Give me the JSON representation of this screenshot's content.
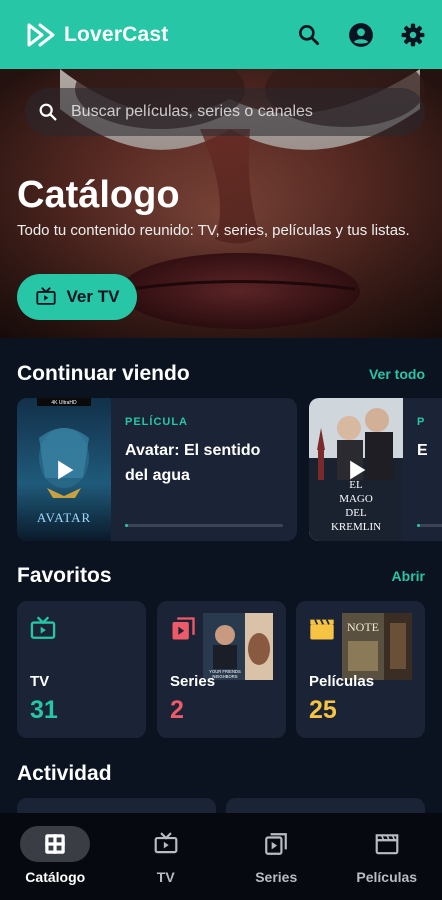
{
  "app": {
    "name": "LoverCast"
  },
  "header": {
    "icons": [
      "search-icon",
      "account-icon",
      "gear-icon"
    ]
  },
  "hero": {
    "search_placeholder": "Buscar películas, series o canales",
    "title": "Catálogo",
    "subtitle": "Todo tu contenido reunido: TV, series, películas y tus listas.",
    "button_label": "Ver TV"
  },
  "continue": {
    "title": "Continuar viendo",
    "link": "Ver todo",
    "items": [
      {
        "type": "PELÍCULA",
        "title": "Avatar: El sentido del agua",
        "poster_text": "AVATAR",
        "poster_badge": "4K UltraHD",
        "progress": 0.02
      },
      {
        "type": "P",
        "title": "E",
        "poster_text": "EL MAGO DEL KREMLIN",
        "progress": 0.1
      }
    ]
  },
  "favorites": {
    "title": "Favoritos",
    "link": "Abrir",
    "items": [
      {
        "label": "TV",
        "count": "31",
        "color": "#26c6a6",
        "icon": "tv-icon"
      },
      {
        "label": "Series",
        "count": "2",
        "color": "#ef5a68",
        "icon": "series-icon",
        "thumb_text": "YOUR FRIENDS NEIGHBORS"
      },
      {
        "label": "Películas",
        "count": "25",
        "color": "#f6c343",
        "icon": "clapper-icon",
        "thumb_text": "NOTE"
      }
    ]
  },
  "activity": {
    "title": "Actividad"
  },
  "nav": {
    "items": [
      {
        "label": "Catálogo",
        "icon": "catalog-icon",
        "active": true
      },
      {
        "label": "TV",
        "icon": "tv-icon",
        "active": false
      },
      {
        "label": "Series",
        "icon": "series-icon",
        "active": false
      },
      {
        "label": "Películas",
        "icon": "clapper-icon",
        "active": false
      }
    ]
  },
  "colors": {
    "accent": "#26c6a6",
    "background": "#0c1320",
    "card": "#1a2436",
    "series": "#ef5a68",
    "movies": "#f6c343"
  }
}
